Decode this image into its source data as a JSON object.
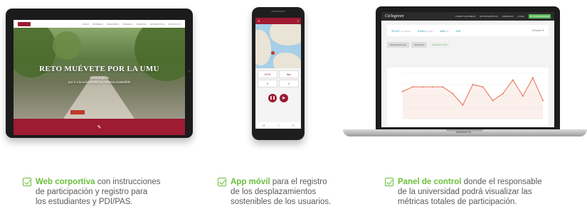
{
  "tablet": {
    "nav_items": [
      "INICIO",
      "PRIMERA",
      "NUESTROS",
      "TRABAJO",
      "RANKING",
      "ESTADÍSTICA",
      "CONTACTO"
    ],
    "hero_title": "RETO MUÉVETE POR LA UMU",
    "hero_subtitle_1": "Gana Jeglook",
    "hero_subtitle_2": "por ir a la universidad de manera sostenible",
    "footer_icon": "pencil-icon"
  },
  "phone": {
    "bar_title": "✕",
    "stats": [
      "00:00",
      "0km",
      "0",
      "0"
    ],
    "nav_glyphs": [
      "◁",
      "○",
      "□"
    ]
  },
  "laptop": {
    "logo": "Ciclogreen",
    "nav_items": [
      "PODER CONTRIBUIR",
      "MIS ESTADÍSTICAS",
      "EMPRESAS",
      "AYUDA"
    ],
    "nav_cta": "MI SOSTENIBILIDAD",
    "kpis": [
      {
        "value": "76.117",
        "unit": "km totales"
      },
      {
        "value": "2.344",
        "unit": "kg CO2"
      },
      {
        "value": "128",
        "unit": "bici"
      },
      {
        "value": "120",
        "unit": ""
      }
    ],
    "period": "Semana ▼",
    "tabs": [
      "Desplazamientos",
      "Kilómetros",
      "Reducción CO2"
    ],
    "active_tab": 2,
    "brand": "MacBook Pro",
    "chart_data": {
      "type": "area",
      "series": [
        {
          "values": [
            12,
            14,
            14,
            14,
            14,
            11,
            6,
            15,
            14,
            8,
            11,
            17,
            10,
            18,
            8
          ]
        }
      ],
      "ylim": [
        0,
        20
      ],
      "grid": true,
      "color": "#e8836b"
    }
  },
  "captions": [
    {
      "highlight": "Web corportiva",
      "line1": " con instrucciones",
      "line2": "de participación y registro para",
      "line3": "los estudiantes y PDI/PAS."
    },
    {
      "highlight": "App móvil",
      "line1": " para el registro",
      "line2": "de los desplazamientos",
      "line3": "sostenibles de los usuarios."
    },
    {
      "highlight": "Panel de control",
      "line1": " donde el responsable",
      "line2": "de la universidad podrá visualizar las",
      "line3": "métricas totales de participación."
    }
  ],
  "colors": {
    "brand_red": "#9e1b32",
    "accent_green": "#6abf3b",
    "chart_line": "#e8836b"
  }
}
